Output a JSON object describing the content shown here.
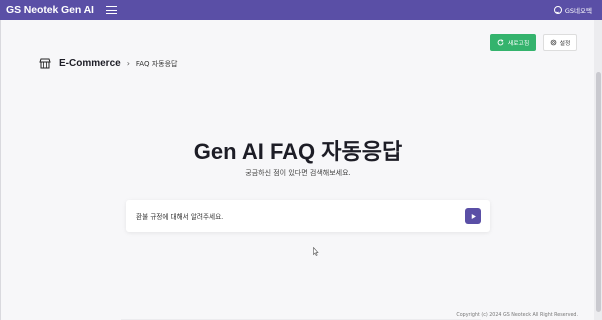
{
  "topbar": {
    "brand": "GS Neotek Gen AI",
    "menu_icon": "menu-icon",
    "user_label": "GS네오텍",
    "user_icon": "smiley-icon"
  },
  "breadcrumb": {
    "icon": "store-icon",
    "main": "E-Commerce",
    "separator": "›",
    "sub": "FAQ 자동응답"
  },
  "actions": {
    "refresh_label": "새로고침",
    "settings_label": "설정"
  },
  "hero": {
    "title": "Gen AI FAQ 자동응답",
    "subtitle": "궁금하신 점이 있다면 검색해보세요."
  },
  "search": {
    "value": "환불 규정에 대해서 알려주세요."
  },
  "footer": {
    "copyright": "Copyright (c) 2024 GS Neoteck All Right Reserved."
  },
  "colors": {
    "brand": "#5a4fa6",
    "refresh_button": "#34b36d"
  }
}
